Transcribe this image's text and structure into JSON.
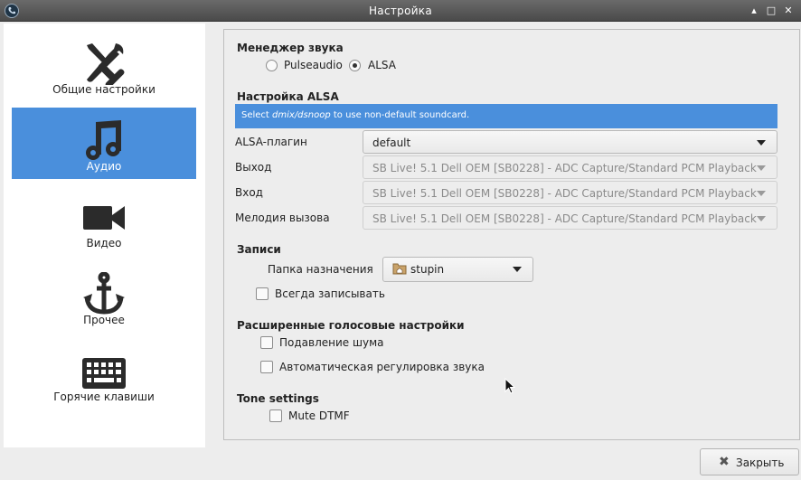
{
  "window": {
    "title": "Настройка",
    "controls": [
      "▴",
      "□",
      "✕"
    ]
  },
  "sidebar": {
    "items": [
      {
        "label": "Общие настройки",
        "icon": "tools-icon",
        "active": false
      },
      {
        "label": "Аудио",
        "icon": "music-note-icon",
        "active": true
      },
      {
        "label": "Видео",
        "icon": "video-camera-icon",
        "active": false
      },
      {
        "label": "Прочее",
        "icon": "anchor-icon",
        "active": false
      },
      {
        "label": "Горячие клавиши",
        "icon": "keyboard-icon",
        "active": false
      }
    ]
  },
  "sound_manager": {
    "title": "Менеджер звука",
    "options": [
      {
        "label": "Pulseaudio",
        "checked": false
      },
      {
        "label": "ALSA",
        "checked": true
      }
    ]
  },
  "alsa": {
    "title": "Настройка ALSA",
    "info_prefix": "Select ",
    "info_emph": "dmix/dsnoop",
    "info_suffix": " to use non-default soundcard.",
    "fields": [
      {
        "label": "ALSA-плагин",
        "value": "default",
        "enabled": true
      },
      {
        "label": "Выход",
        "value": "SB Live! 5.1 Dell OEM [SB0228] - ADC Capture/Standard PCM Playback",
        "enabled": false
      },
      {
        "label": "Вход",
        "value": "SB Live! 5.1 Dell OEM [SB0228] - ADC Capture/Standard PCM Playback",
        "enabled": false
      },
      {
        "label": "Мелодия вызова",
        "value": "SB Live! 5.1 Dell OEM [SB0228] - ADC Capture/Standard PCM Playback",
        "enabled": false
      }
    ]
  },
  "records": {
    "title": "Записи",
    "folder_label": "Папка назначения",
    "folder_value": "stupin",
    "always_record": {
      "label": "Всегда записывать",
      "checked": false
    }
  },
  "advanced": {
    "title": "Расширенные голосовые настройки",
    "noise_suppression": {
      "label": "Подавление шума",
      "checked": false
    },
    "agc": {
      "label": "Автоматическая регулировка звука",
      "checked": false
    }
  },
  "tone": {
    "title": "Tone settings",
    "mute_dtmf": {
      "label": "Mute DTMF",
      "checked": false
    }
  },
  "footer": {
    "close_label": "Закрыть"
  },
  "colors": {
    "accent": "#4a8fdc",
    "titlebar": "#555555",
    "background": "#ededed"
  }
}
